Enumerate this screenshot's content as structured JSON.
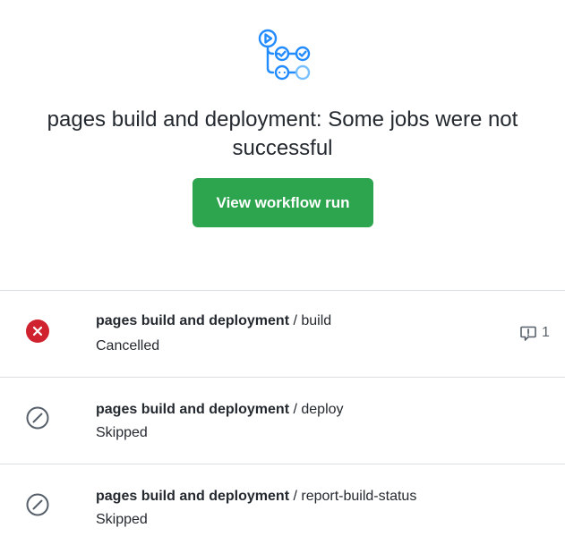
{
  "title_line1": "pages build and deployment: Some jobs were not",
  "title_line2": "successful",
  "button_label": "View workflow run",
  "jobs": [
    {
      "workflow": "pages build and deployment",
      "separator": " / ",
      "job": "build",
      "status": "Cancelled",
      "status_icon": "x-circle-fill-icon",
      "annotation_count": "1"
    },
    {
      "workflow": "pages build and deployment",
      "separator": " / ",
      "job": "deploy",
      "status": "Skipped",
      "status_icon": "skip-icon"
    },
    {
      "workflow": "pages build and deployment",
      "separator": " / ",
      "job": "report-build-status",
      "status": "Skipped",
      "status_icon": "skip-icon"
    }
  ],
  "colors": {
    "success": "#2da44e",
    "danger": "#cf222e",
    "muted": "#57606a",
    "actions_blue": "#218bff"
  }
}
